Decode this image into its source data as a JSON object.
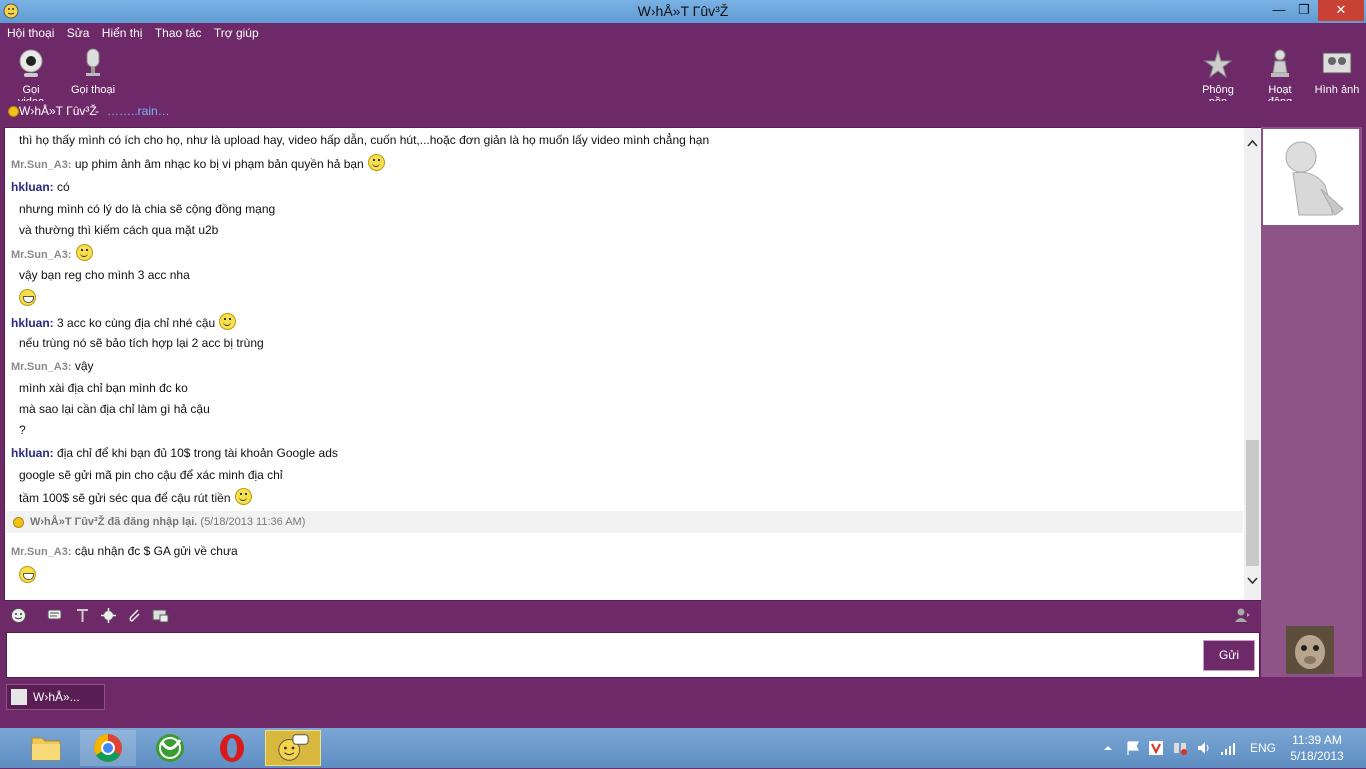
{
  "window": {
    "title": "W›hÅ»T Γûv³Ž",
    "colors": {
      "theme": "#6e2a68",
      "titlebar": "#6fa8dc",
      "close": "#c94034"
    }
  },
  "menu": [
    "Hội thoại",
    "Sửa",
    "Hiển thị",
    "Thao tác",
    "Trợ giúp"
  ],
  "toolbar": {
    "left": [
      {
        "label": "Gọi video",
        "icon": "webcam-icon"
      },
      {
        "label": "Gọi thoại",
        "icon": "microphone-icon"
      }
    ],
    "right": [
      {
        "label": "Phông nền",
        "icon": "background-icon"
      },
      {
        "label": "Hoạt động",
        "icon": "chess-piece-icon"
      },
      {
        "label": "Hình ảnh",
        "icon": "photos-icon"
      }
    ]
  },
  "contact": {
    "name": "W›hÅ»T Γûv³Ž",
    "separator": "-",
    "status_message": "……..rain…"
  },
  "messages": [
    {
      "sender": "",
      "text": "thì họ thấy mình có ích cho họ, như là upload hay, video hấp dẫn, cuốn hút,...hoặc đơn giản là họ muốn lấy video mình chẳng hạn",
      "emoticon": ""
    },
    {
      "sender": "Mr.Sun_A3:",
      "text": "up phim ảnh âm nhạc ko bị vi phạm bản quyền hả bạn",
      "emoticon": "smile"
    },
    {
      "sender": "hkluan:",
      "text": "có",
      "emoticon": ""
    },
    {
      "sender": "",
      "text": "nhưng mình có lý do là chia sẽ cộng đồng mạng",
      "emoticon": ""
    },
    {
      "sender": "",
      "text": "và thường thì kiếm cách qua mặt u2b",
      "emoticon": ""
    },
    {
      "sender": "Mr.Sun_A3:",
      "text": "",
      "emoticon": "smile"
    },
    {
      "sender": "",
      "text": "vậy bạn reg cho mình 3 acc nha",
      "emoticon": ""
    },
    {
      "sender": "",
      "text": "",
      "emoticon": "grin"
    },
    {
      "sender": "hkluan:",
      "text": "3 acc ko cùng địa chỉ nhé cậu",
      "emoticon": "smile"
    },
    {
      "sender": "",
      "text": "nếu trùng nó sẽ bảo tích hợp lại 2 acc bị trùng",
      "emoticon": ""
    },
    {
      "sender": "Mr.Sun_A3:",
      "text": "vậy",
      "emoticon": ""
    },
    {
      "sender": "",
      "text": "mình xài địa chỉ bạn mình đc ko",
      "emoticon": ""
    },
    {
      "sender": "",
      "text": "mà sao lại cần địa chỉ làm gì hả cậu",
      "emoticon": ""
    },
    {
      "sender": "",
      "text": "?",
      "emoticon": ""
    },
    {
      "sender": "hkluan:",
      "text": "địa chỉ để khi bạn đủ 10$ trong tài khoản Google ads",
      "emoticon": ""
    },
    {
      "sender": "",
      "text": "google sẽ gửi mã pin cho cậu để xác minh địa chỉ",
      "emoticon": ""
    },
    {
      "sender": "",
      "text": "tầm 100$ sẽ gửi séc qua để cậu rút tiền",
      "emoticon": "smile"
    }
  ],
  "notice": {
    "text": "W›hÅ»T Γûv³Ž đã đăng nhập lại.",
    "timestamp": "(5/18/2013 11:36 AM)"
  },
  "after_notice": [
    {
      "sender": "Mr.Sun_A3:",
      "text": "cậu nhận đc $ GA gửi về chưa",
      "emoticon": ""
    },
    {
      "sender": "",
      "text": "",
      "emoticon": "grin"
    }
  ],
  "composer": {
    "send_label": "Gửi",
    "value": ""
  },
  "tab": {
    "label": "W›hÅ»..."
  },
  "taskbar": {
    "lang": "ENG",
    "time": "11:39 AM",
    "date": "5/18/2013"
  }
}
